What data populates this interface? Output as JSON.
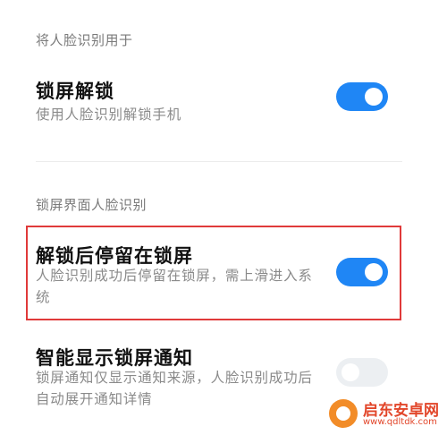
{
  "section1": {
    "header": "将人脸识别用于",
    "rows": [
      {
        "title": "锁屏解锁",
        "subtitle_lines": [
          "使用人脸识别解锁手机"
        ],
        "enabled": true
      }
    ]
  },
  "section2": {
    "header": "锁屏界面人脸识别",
    "rows": [
      {
        "title": "解锁后停留在锁屏",
        "subtitle_lines": [
          "人脸识别成功后停留在锁屏，需上滑进入系",
          "统"
        ],
        "enabled": true
      },
      {
        "title": "智能显示锁屏通知",
        "subtitle_lines": [
          "锁屏通知仅显示通知来源，人脸识别成功后",
          "自动展开通知详情"
        ],
        "enabled": false
      }
    ]
  },
  "watermark": {
    "name": "启东安卓网",
    "url": "www.qdltdk.com"
  },
  "colors": {
    "toggle_on": "#1f86f5",
    "toggle_off": "#eceff2",
    "highlight_border": "#e03a3a"
  }
}
